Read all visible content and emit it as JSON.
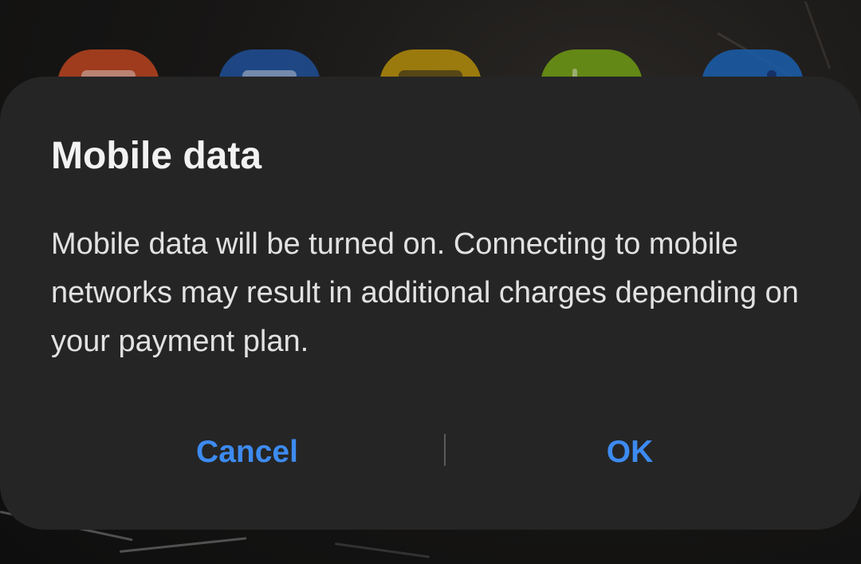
{
  "home_screen": {
    "app_icons": [
      {
        "name": "app-icon-orange",
        "color": "#b8431f"
      },
      {
        "name": "app-icon-blue",
        "color": "#1f4f97"
      },
      {
        "name": "app-icon-yellow",
        "color": "#b18b0b"
      },
      {
        "name": "app-icon-green",
        "color": "#6f9a13"
      },
      {
        "name": "app-icon-light-blue",
        "color": "#1a5fae"
      }
    ]
  },
  "dialog": {
    "title": "Mobile data",
    "message": "Mobile data will be turned on. Connecting to mobile networks may result in additional charges depending on your payment plan.",
    "buttons": {
      "cancel": "Cancel",
      "ok": "OK"
    },
    "colors": {
      "background": "#252525",
      "accent": "#3d8bf0",
      "title_text": "#f2f2f2",
      "body_text": "#e2e2e2"
    }
  }
}
